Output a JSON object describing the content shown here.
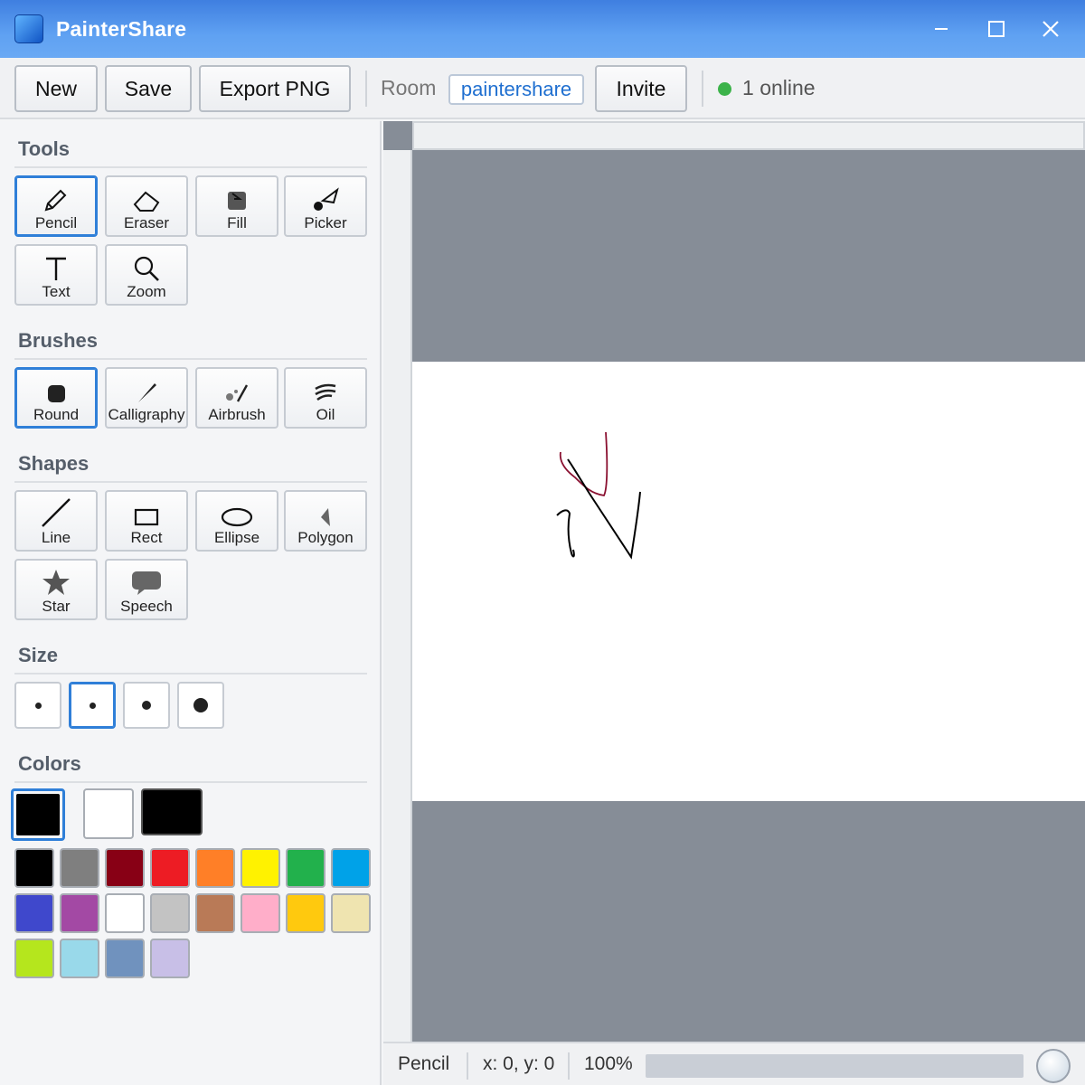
{
  "window": {
    "title": "PainterShare"
  },
  "toolbar": {
    "new_label": "New",
    "save_label": "Save",
    "export_label": "Export PNG",
    "room_label": "Room",
    "room_value": "paintershare",
    "invite_label": "Invite",
    "online_count": "1",
    "online_label": "online"
  },
  "sidebar": {
    "tools_title": "Tools",
    "tools": [
      {
        "label": "Pencil",
        "icon": "pencil-icon",
        "active": true
      },
      {
        "label": "Eraser",
        "icon": "eraser-icon"
      },
      {
        "label": "Fill",
        "icon": "fill-bucket-icon"
      },
      {
        "label": "Picker",
        "icon": "color-picker-icon"
      },
      {
        "label": "Text",
        "icon": "text-icon"
      },
      {
        "label": "Zoom",
        "icon": "magnifier-icon"
      }
    ],
    "brushes_title": "Brushes",
    "brushes": [
      {
        "label": "Round",
        "icon": "round-brush-icon",
        "active": true
      },
      {
        "label": "Calligraphy",
        "icon": "calligraphy-brush-icon"
      },
      {
        "label": "Airbrush",
        "icon": "airbrush-icon"
      },
      {
        "label": "Oil",
        "icon": "oil-brush-icon"
      }
    ],
    "shapes_title": "Shapes",
    "shapes": [
      {
        "label": "Line",
        "icon": "line-icon"
      },
      {
        "label": "Rect",
        "icon": "rectangle-icon"
      },
      {
        "label": "Ellipse",
        "icon": "ellipse-icon"
      },
      {
        "label": "Polygon",
        "icon": "polygon-icon"
      },
      {
        "label": "Star",
        "icon": "star-icon"
      },
      {
        "label": "Speech",
        "icon": "speech-bubble-icon"
      }
    ],
    "size_title": "Size",
    "selected_size_index": 1,
    "colors_title": "Colors",
    "primary_color": "#000000",
    "secondary_color": "#ffffff",
    "preview_color": "#000000",
    "palette": [
      "#000000",
      "#7f7f7f",
      "#880015",
      "#ed1c24",
      "#ff7f27",
      "#fff200",
      "#22b14c",
      "#00a2e8",
      "#3f48cc",
      "#a349a4",
      "#ffffff",
      "#c3c3c3",
      "#b97a57",
      "#ffaec9",
      "#ffc90e",
      "#efe4b0",
      "#b5e61d",
      "#99d9ea",
      "#7092be",
      "#c8bfe7"
    ]
  },
  "canvas": {
    "background": "#868d97",
    "paper_color": "#ffffff",
    "stroke_colors": [
      "#8a1030",
      "#000000"
    ]
  },
  "status": {
    "tool": "Pencil",
    "coords": "x: 0, y: 0",
    "zoom": "100%"
  }
}
